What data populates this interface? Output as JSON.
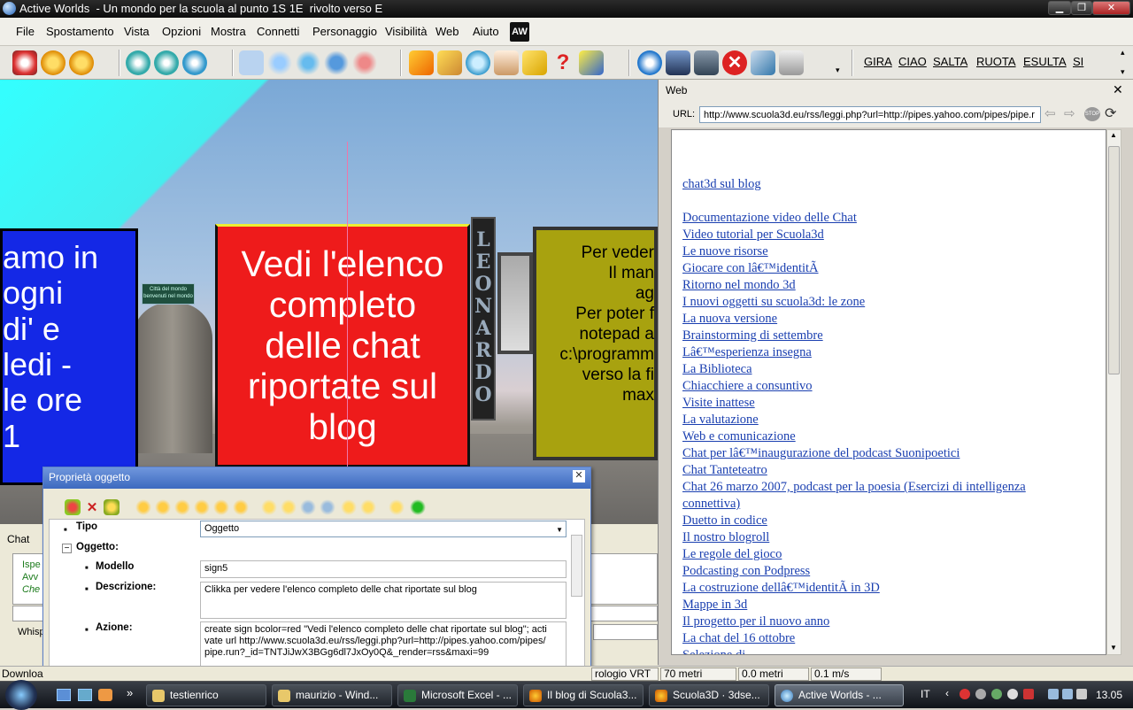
{
  "window": {
    "title": "Active Worlds  - Un mondo per la scuola al punto 1S 1E  rivolto verso E"
  },
  "menu": [
    "File",
    "Spostamento",
    "Vista",
    "Opzioni",
    "Mostra",
    "Connetti",
    "Personaggio",
    "Visibilità",
    "Web",
    "Aiuto"
  ],
  "gestures": [
    "GIRA",
    "CIAO",
    "SALTA",
    "RUOTA",
    "ESULTA",
    "SI"
  ],
  "scene": {
    "left_sign": [
      "amo in",
      "ogni",
      "di' e",
      "ledi -",
      "le ore",
      "1"
    ],
    "center_sign": "Vedi l'elenco completo delle chat riportate sul blog",
    "yellow_sign": [
      "Per veder",
      "Il man",
      "ag",
      "Per poter f",
      "notepad a",
      "c:\\programm",
      "verso la fi",
      "max"
    ],
    "leonardo": "LEONARDO",
    "small_sign": [
      "Città del mondo",
      "benvenuti nel mondo"
    ]
  },
  "web": {
    "title": "Web",
    "url_label": "URL:",
    "url": "http://www.scuola3d.eu/rss/leggi.php?url=http://pipes.yahoo.com/pipes/pipe.r",
    "heading_link": "chat3d   sul blog",
    "links": [
      "Documentazione video delle Chat",
      "Video tutorial per Scuola3d",
      "Le nuove risorse",
      "Giocare con lâ€™identitÃ ",
      "Ritorno nel mondo 3d",
      "I nuovi oggetti su scuola3d: le zone",
      "La nuova versione",
      "Brainstorming di settembre",
      "Lâ€™esperienza insegna",
      "La Biblioteca",
      "Chiacchiere a consuntivo",
      "Visite inattese",
      "La valutazione",
      "Web e comunicazione",
      "Chat per lâ€™inaugurazione del podcast Suonipoetici",
      "Chat Tanteteatro",
      "Chat 26 marzo 2007, podcast per la poesia (Esercizi di intelligenza",
      "connettiva)",
      "Duetto in codice",
      "Il nostro blogroll",
      "Le regole del gioco",
      "Podcasting con Podpress",
      "La costruzione dellâ€™identitÃ  in 3D",
      "Mappe in 3d",
      "Il progetto per il nuovo anno",
      "La chat del 16 ottobre",
      "Selezione di ..."
    ]
  },
  "chat": {
    "tab": "Chat",
    "lines": [
      "Ispe",
      "Avv",
      "Che"
    ],
    "whisper": "Whisp"
  },
  "props": {
    "title": "Proprietà oggetto",
    "tipo_label": "Tipo",
    "tipo_value": "Oggetto",
    "oggetto_label": "Oggetto:",
    "modello_label": "Modello",
    "modello_value": "sign5",
    "descrizione_label": "Descrizione:",
    "descrizione_value": "Clikka per vedere l'elenco completo delle chat riportate sul blog",
    "azione_label": "Azione:",
    "azione_value": "create sign bcolor=red  \"Vedi l'elenco completo delle chat riportate sul blog\"; activate url http://www.scuola3d.eu/rss/leggi.php?url=http://pipes.yahoo.com/pipes/pipe.run?_id=TNTJiJwX3BGg6dl7JxOy0Q&_render=rss&maxi=99"
  },
  "status": {
    "left": "Downloa",
    "clock": "rologio VRT",
    "dist1": "70 metri",
    "dist2": "0.0 metri",
    "speed": "0.1 m/s"
  },
  "taskbar": {
    "tasks": [
      "testienrico",
      "maurizio - Wind...",
      "Microsoft Excel - ...",
      "Il blog di Scuola3...",
      "Scuola3D · 3dse...",
      "Active Worlds - ..."
    ],
    "lang": "IT",
    "time": "13.05"
  }
}
